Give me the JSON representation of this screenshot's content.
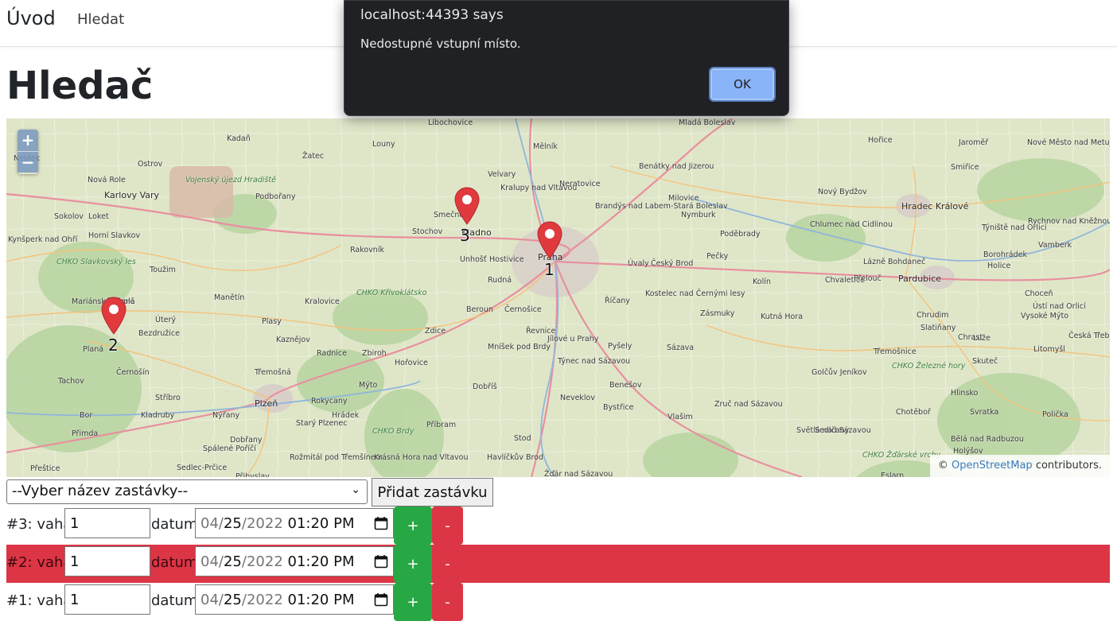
{
  "navbar": {
    "brand": "Úvod",
    "link_search": "Hledat"
  },
  "page": {
    "title": "Hledač"
  },
  "map": {
    "attribution_prefix": "©",
    "attribution_link": "OpenStreetMap",
    "attribution_suffix": "contributors.",
    "zoom_in": "+",
    "zoom_out": "−",
    "markers": [
      {
        "label": "1"
      },
      {
        "label": "2"
      },
      {
        "label": "3"
      }
    ],
    "places": [
      "Kadaň",
      "Louny",
      "Libochovice",
      "Mělník",
      "Mladá Boleslav",
      "Hořice",
      "Jaroměř",
      "Nové Město nad Metují",
      "Nejdek",
      "Ostrov",
      "Žatec",
      "Velvary",
      "Benátky nad Jizerou",
      "Nová Role",
      "Karlovy Vary",
      "Vojenský újezd Hradiště",
      "Podbořany",
      "Kralupy nad Vltavou",
      "Neratovice",
      "Brandýs nad Labem-Stará Boleslav",
      "Milovice",
      "Nový Bydžov",
      "Hradec Králové",
      "Smiřice",
      "Sokolov",
      "Loket",
      "Horní Slavkov",
      "Smečno",
      "Stochov",
      "Kladno",
      "Nymburk",
      "Chlumec nad Cidlinou",
      "Poděbrady",
      "Týniště nad Orlicí",
      "Rychnov nad Kněžnou",
      "Vamberk",
      "Kynšperk nad Ohří",
      "CHKO Slavkovský les",
      "Toužim",
      "Rakovník",
      "Unhošť",
      "Hostivice",
      "Praha",
      "Úvaly",
      "Český Brod",
      "Pečky",
      "Lázně Bohdaneč",
      "Borohrádek",
      "Rudná",
      "Kolín",
      "Chvaletice",
      "Přelouč",
      "Pardubice",
      "Holice",
      "Mariánské Lázně",
      "Teplá",
      "Manětín",
      "Kralovice",
      "CHKO Křivoklátsko",
      "Beroun",
      "Černošice",
      "Kostelec nad Černými lesy",
      "Říčany",
      "Choceň",
      "Ústí nad Orlicí",
      "Bezdružice",
      "Planá",
      "Úterý",
      "Plasy",
      "Řevnice",
      "Jílové u Prahy",
      "Zásmuky",
      "Kutná Hora",
      "Chrudim",
      "Slatiňany",
      "Vysoké Mýto",
      "Kaznějov",
      "Zdice",
      "Mníšek pod Brdy",
      "Pyšely",
      "Sázava",
      "Třemošnice",
      "Luže",
      "Chrast",
      "Česká Třebová",
      "Litomyšl",
      "Černošín",
      "Radnice",
      "Zbiroh",
      "Hořovice",
      "Týnec nad Sázavou",
      "Golčův Jeníkov",
      "Skuteč",
      "Tachov",
      "Stříbro",
      "Třemošná",
      "Mýto",
      "Dobříš",
      "Benešov",
      "CHKO Železné hory",
      "Hlinsko",
      "Bor",
      "Kladruby",
      "Nýřany",
      "Plzeň",
      "Rokycany",
      "Hrádek",
      "Neveklov",
      "Bystřice",
      "Zruč nad Sázavou",
      "Chotěboř",
      "Svratka",
      "Polička",
      "Přimda",
      "Dobřany",
      "Starý Plzenec",
      "CHKO Brdy",
      "Příbram",
      "Vlašim",
      "Světlá nad Sázavou",
      "Sedlčany",
      "Stod",
      "Spálené Poříčí",
      "Rožmitál pod Třemšínem",
      "Krásná Hora nad Vltavou",
      "Havlíčkův Brod",
      "CHKO Žďárské vrchy",
      "Bělá nad Radbuzou",
      "Holýšov",
      "Přeštice",
      "Sedlec-Prčice",
      "Přibyslav",
      "Žďár nad Sázavou",
      "Eslarn"
    ]
  },
  "form": {
    "select_placeholder": "--Vyber název zastávky--",
    "add_stop_button": "Přidat zastávku",
    "label_datum": "datum",
    "plus": "+",
    "minus": "-",
    "stops": [
      {
        "label": "#3: vaha",
        "weight": "1",
        "date_mm": "04",
        "date_dd": "25",
        "date_yyyy": "2022",
        "time": "01:20",
        "ampm": "PM",
        "highlighted": false
      },
      {
        "label": "#2: vaha",
        "weight": "1",
        "date_mm": "04",
        "date_dd": "25",
        "date_yyyy": "2022",
        "time": "01:20",
        "ampm": "PM",
        "highlighted": true
      },
      {
        "label": "#1: vaha",
        "weight": "1",
        "date_mm": "04",
        "date_dd": "25",
        "date_yyyy": "2022",
        "time": "01:20",
        "ampm": "PM",
        "highlighted": false
      }
    ]
  },
  "dialog": {
    "title": "localhost:44393 says",
    "message": "Nedostupné vstupní místo.",
    "ok": "OK"
  },
  "colors": {
    "success": "#28a745",
    "danger": "#dc3545",
    "marker": "#e0393e",
    "dialog_bg": "#202124",
    "dialog_button": "#8ab4f8"
  }
}
